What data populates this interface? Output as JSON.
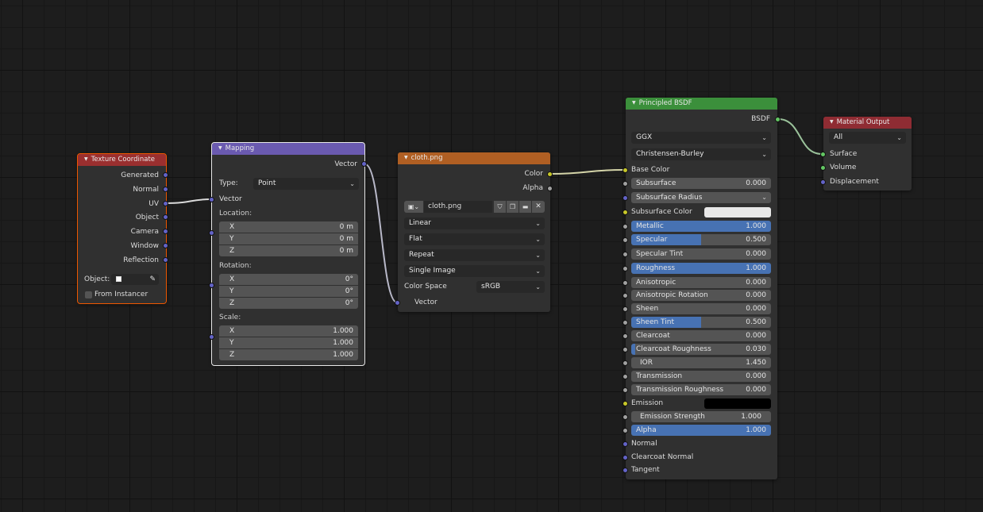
{
  "texture_coordinate": {
    "title": "Texture Coordinate",
    "outputs": [
      "Generated",
      "Normal",
      "UV",
      "Object",
      "Camera",
      "Window",
      "Reflection"
    ],
    "object_label": "Object:",
    "from_instancer": "From Instancer"
  },
  "mapping": {
    "title": "Mapping",
    "output": "Vector",
    "type_label": "Type:",
    "type_value": "Point",
    "input_vector": "Vector",
    "location_label": "Location:",
    "location": [
      {
        "axis": "X",
        "value": "0 m"
      },
      {
        "axis": "Y",
        "value": "0 m"
      },
      {
        "axis": "Z",
        "value": "0 m"
      }
    ],
    "rotation_label": "Rotation:",
    "rotation": [
      {
        "axis": "X",
        "value": "0°"
      },
      {
        "axis": "Y",
        "value": "0°"
      },
      {
        "axis": "Z",
        "value": "0°"
      }
    ],
    "scale_label": "Scale:",
    "scale": [
      {
        "axis": "X",
        "value": "1.000"
      },
      {
        "axis": "Y",
        "value": "1.000"
      },
      {
        "axis": "Z",
        "value": "1.000"
      }
    ]
  },
  "image_texture": {
    "title": "cloth.png",
    "outputs": [
      "Color",
      "Alpha"
    ],
    "image_name": "cloth.png",
    "interpolation": "Linear",
    "projection": "Flat",
    "extension": "Repeat",
    "source": "Single Image",
    "color_space_label": "Color Space",
    "color_space": "sRGB",
    "input_vector": "Vector"
  },
  "principled": {
    "title": "Principled BSDF",
    "output": "BSDF",
    "distribution": "GGX",
    "subsurface_method": "Christensen-Burley",
    "base_color": "Base Color",
    "subsurface": {
      "label": "Subsurface",
      "value": "0.000",
      "fill": 0
    },
    "subsurface_radius": "Subsurface Radius",
    "subsurface_color": "Subsurface Color",
    "subsurface_color_hex": "#e8e8e8",
    "metallic": {
      "label": "Metallic",
      "value": "1.000",
      "fill": 1
    },
    "specular": {
      "label": "Specular",
      "value": "0.500",
      "fill": 0.5
    },
    "specular_tint": {
      "label": "Specular Tint",
      "value": "0.000",
      "fill": 0
    },
    "roughness": {
      "label": "Roughness",
      "value": "1.000",
      "fill": 1
    },
    "anisotropic": {
      "label": "Anisotropic",
      "value": "0.000",
      "fill": 0
    },
    "anisotropic_rotation": {
      "label": "Anisotropic Rotation",
      "value": "0.000",
      "fill": 0
    },
    "sheen": {
      "label": "Sheen",
      "value": "0.000",
      "fill": 0
    },
    "sheen_tint": {
      "label": "Sheen Tint",
      "value": "0.500",
      "fill": 0.5
    },
    "clearcoat": {
      "label": "Clearcoat",
      "value": "0.000",
      "fill": 0
    },
    "clearcoat_roughness": {
      "label": "Clearcoat Roughness",
      "value": "0.030",
      "fill": 0.03
    },
    "ior": {
      "label": "IOR",
      "value": "1.450"
    },
    "transmission": {
      "label": "Transmission",
      "value": "0.000",
      "fill": 0
    },
    "transmission_roughness": {
      "label": "Transmission Roughness",
      "value": "0.000",
      "fill": 0
    },
    "emission": "Emission",
    "emission_color_hex": "#000000",
    "emission_strength": {
      "label": "Emission Strength",
      "value": "1.000"
    },
    "alpha": {
      "label": "Alpha",
      "value": "1.000",
      "fill": 1
    },
    "normal": "Normal",
    "clearcoat_normal": "Clearcoat Normal",
    "tangent": "Tangent"
  },
  "material_output": {
    "title": "Material Output",
    "target": "All",
    "inputs": [
      "Surface",
      "Volume",
      "Displacement"
    ]
  },
  "colors": {
    "header_input": "#9a2f2f",
    "header_vector": "#6a5ab0",
    "header_texture": "#b05f23",
    "header_shader": "#3b8f3b",
    "header_output": "#8f2c33",
    "accent": "#4772b3"
  }
}
